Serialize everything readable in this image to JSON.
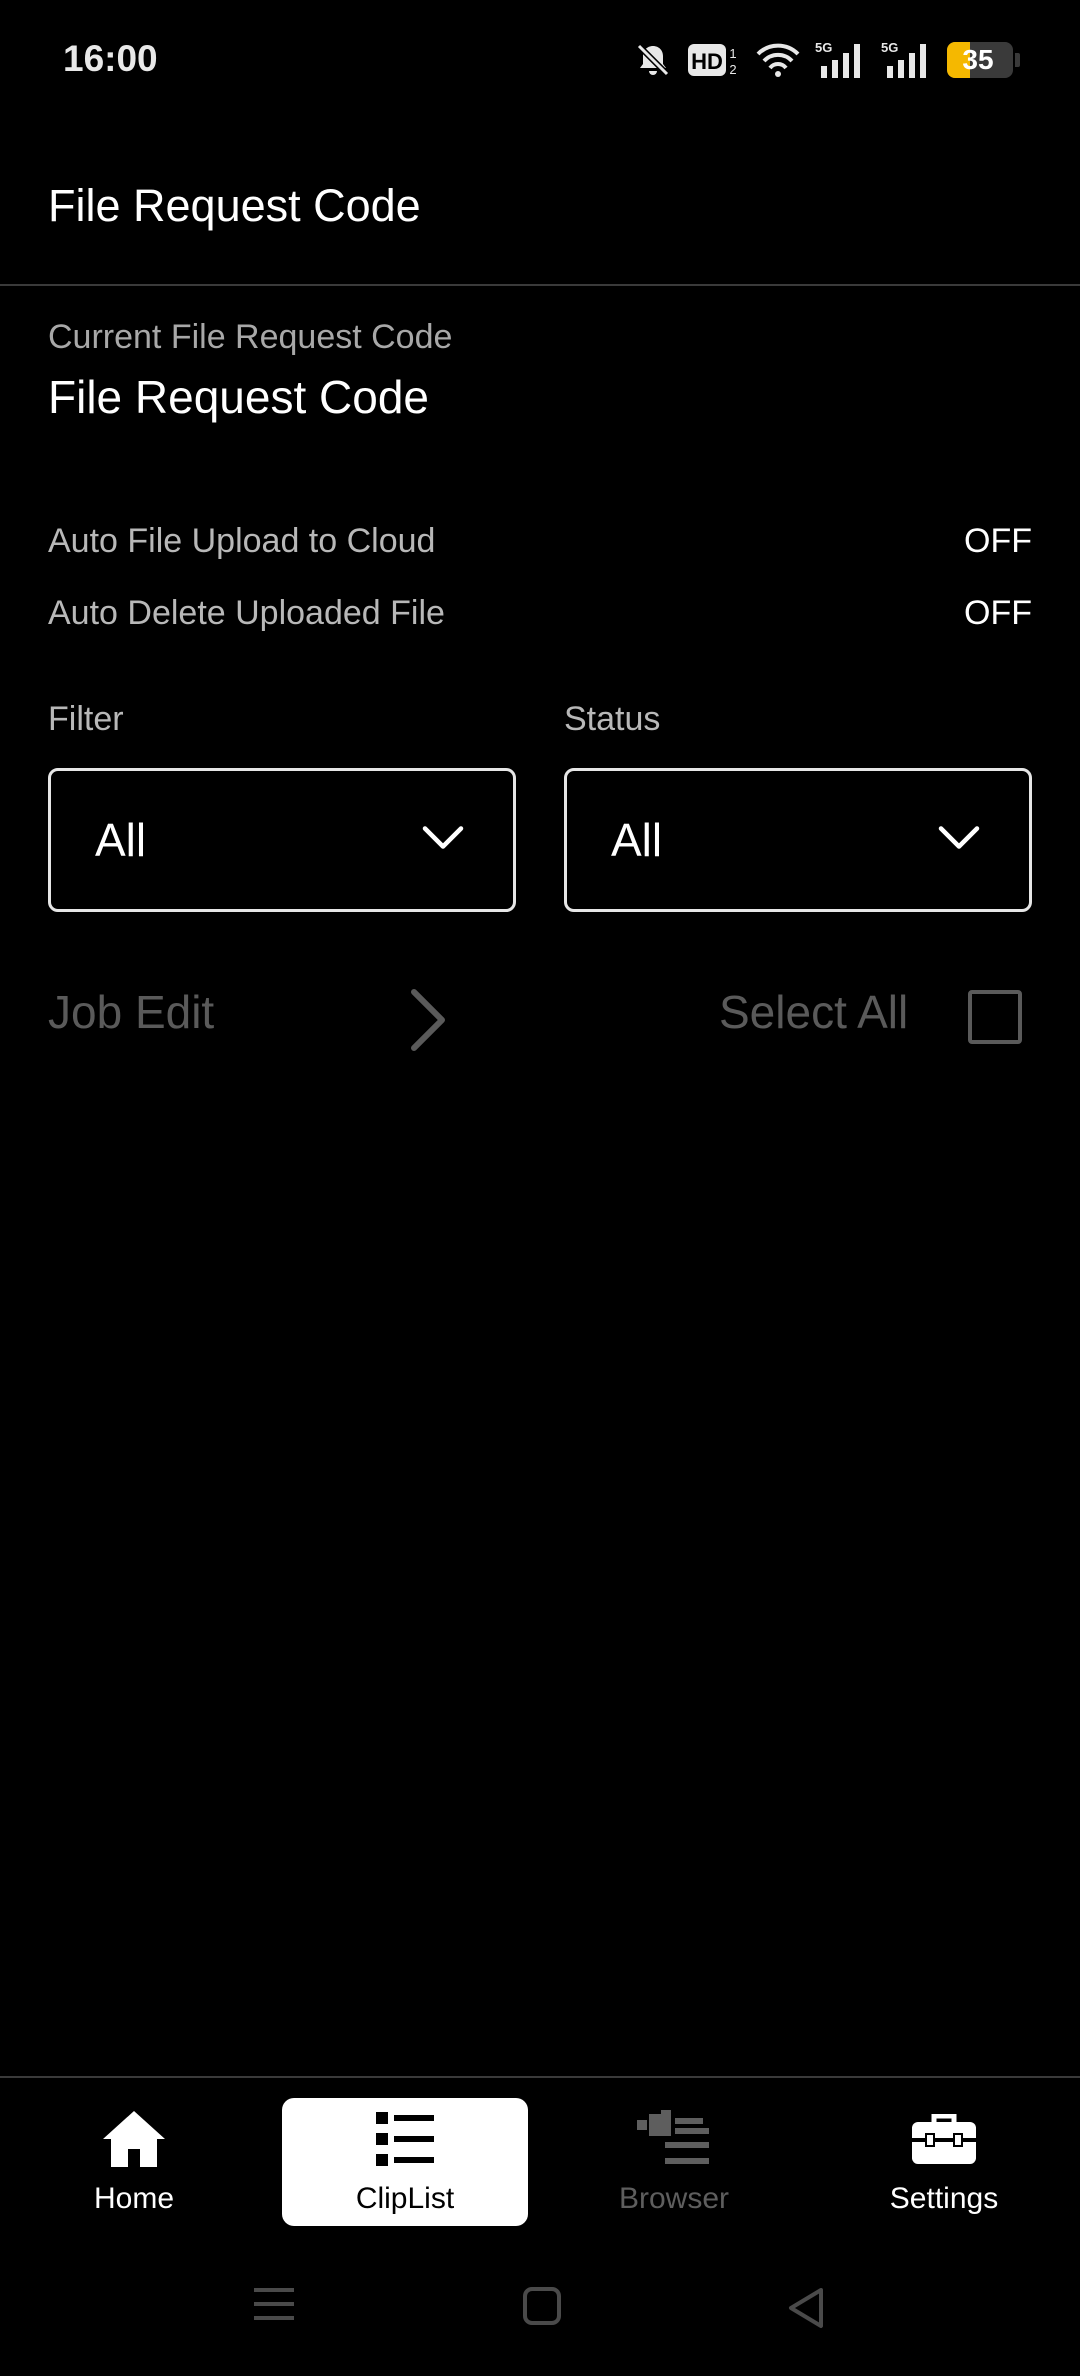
{
  "status_bar": {
    "time": "16:00",
    "battery_level": "35",
    "battery_fraction": 0.35,
    "battery_color": "#f5b800",
    "icons": [
      "bell-off-icon",
      "hd-icon",
      "wifi-icon",
      "signal-5g-icon",
      "signal-5g-icon",
      "battery-icon"
    ]
  },
  "header": {
    "title": "File Request Code"
  },
  "code": {
    "label": "Current File Request Code",
    "value": "File Request Code"
  },
  "settings": [
    {
      "label": "Auto File Upload to Cloud",
      "value": "OFF"
    },
    {
      "label": "Auto Delete Uploaded File",
      "value": "OFF"
    }
  ],
  "filter": {
    "label": "Filter",
    "value": "All"
  },
  "status": {
    "label": "Status",
    "value": "All"
  },
  "actions": {
    "job_edit": "Job Edit",
    "select_all": "Select All"
  },
  "bottom_nav": [
    {
      "label": "Home",
      "icon": "home-icon",
      "state": "normal"
    },
    {
      "label": "ClipList",
      "icon": "list-icon",
      "state": "selected"
    },
    {
      "label": "Browser",
      "icon": "camera-list-icon",
      "state": "disabled"
    },
    {
      "label": "Settings",
      "icon": "toolbox-icon",
      "state": "normal"
    }
  ],
  "colors": {
    "background": "#000000",
    "text": "#ffffff",
    "muted": "#b8b8b8",
    "disabled": "#5a5a5a"
  }
}
